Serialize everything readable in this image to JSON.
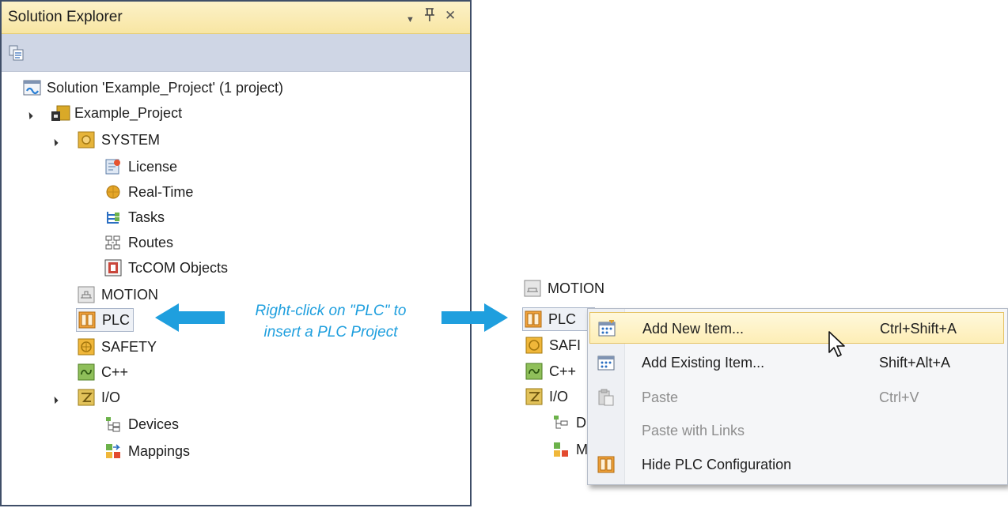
{
  "solution_explorer": {
    "title": "Solution Explorer",
    "window_buttons": {
      "dropdown": "▼",
      "pin": "ᵽ",
      "close": "✕"
    },
    "solution_label": "Solution 'Example_Project' (1 project)",
    "project_label": "Example_Project",
    "system": {
      "label": "SYSTEM",
      "children": [
        "License",
        "Real-Time",
        "Tasks",
        "Routes",
        "TcCOM Objects"
      ]
    },
    "motion_label": "MOTION",
    "plc_label": "PLC",
    "safety_label": "SAFETY",
    "cpp_label": "C++",
    "io": {
      "label": "I/O",
      "children": [
        "Devices",
        "Mappings"
      ]
    }
  },
  "callout": {
    "line1": "Right-click on \"PLC\" to",
    "line2": "insert a PLC Project",
    "color": "#1f9fde"
  },
  "right_tree": {
    "motion_label": "MOTION",
    "plc_label": "PLC",
    "safety_partial": "SAFI",
    "cpp_partial": "C++",
    "io_partial": "I/O",
    "devices_partial": "D",
    "mappings_partial": "M"
  },
  "context_menu": {
    "items": [
      {
        "label": "Add New Item...",
        "shortcut": "Ctrl+Shift+A",
        "highlighted": true,
        "enabled": true,
        "icon": "add-new-item-icon"
      },
      {
        "label": "Add Existing Item...",
        "shortcut": "Shift+Alt+A",
        "highlighted": false,
        "enabled": true,
        "icon": "add-existing-item-icon"
      },
      {
        "label": "Paste",
        "shortcut": "Ctrl+V",
        "highlighted": false,
        "enabled": false,
        "icon": "paste-icon"
      },
      {
        "label": "Paste with Links",
        "shortcut": "",
        "highlighted": false,
        "enabled": false,
        "icon": ""
      },
      {
        "label": "Hide PLC Configuration",
        "shortcut": "",
        "highlighted": false,
        "enabled": true,
        "icon": "plc-icon"
      }
    ]
  },
  "colors": {
    "accent_blue": "#1f9fde",
    "titlebar_yellow": "#f8e6a3",
    "toolbar_bg": "#cfd6e5",
    "menu_highlight": "#fdeeb6"
  }
}
